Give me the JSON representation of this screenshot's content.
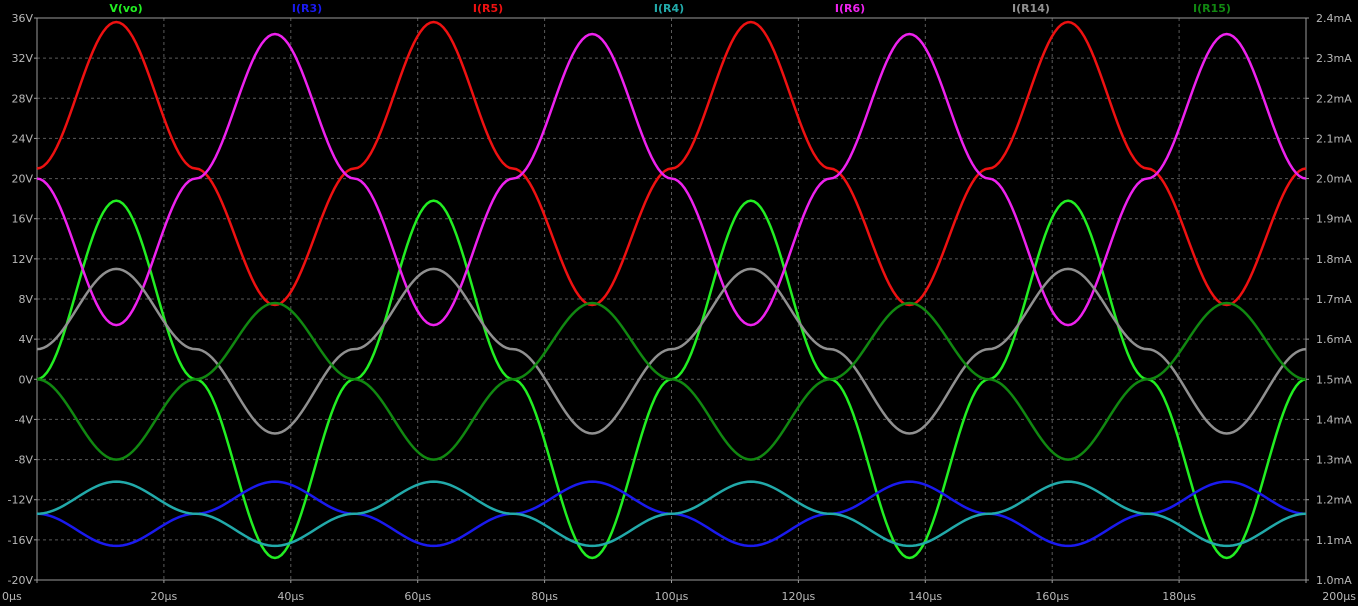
{
  "chart_data": {
    "type": "line",
    "x_unit": "µs",
    "xlim": [
      0,
      200
    ],
    "left_axis": {
      "unit": "V",
      "ylim": [
        -20,
        36
      ],
      "ticks": [
        -20,
        -16,
        -12,
        -8,
        -4,
        0,
        4,
        8,
        12,
        16,
        20,
        24,
        28,
        32,
        36
      ],
      "tick_labels": [
        "-20V",
        "-16V",
        "-12V",
        "-8V",
        "-4V",
        "0V",
        "4V",
        "8V",
        "12V",
        "16V",
        "20V",
        "24V",
        "28V",
        "32V",
        "36V"
      ]
    },
    "right_axis": {
      "unit": "mA",
      "ylim": [
        1.0,
        2.4
      ],
      "ticks": [
        1.0,
        1.1,
        1.2,
        1.3,
        1.4,
        1.5,
        1.6,
        1.7,
        1.8,
        1.9,
        2.0,
        2.1,
        2.2,
        2.3,
        2.4
      ],
      "tick_labels": [
        "1.0mA",
        "1.1mA",
        "1.2mA",
        "1.3mA",
        "1.4mA",
        "1.5mA",
        "1.6mA",
        "1.7mA",
        "1.8mA",
        "1.9mA",
        "2.0mA",
        "2.1mA",
        "2.2mA",
        "2.3mA",
        "2.4mA"
      ]
    },
    "x_ticks": [
      0,
      20,
      40,
      60,
      80,
      100,
      120,
      140,
      160,
      180,
      200
    ],
    "x_tick_labels": [
      "0µs",
      "20µs",
      "40µs",
      "60µs",
      "80µs",
      "100µs",
      "120µs",
      "140µs",
      "160µs",
      "180µs",
      "200µs"
    ],
    "grid": true,
    "legend_position": "top",
    "series": [
      {
        "name": "V(vo)",
        "axis": "left",
        "color": "#22ee22",
        "x": [
          0,
          12.5,
          25,
          37.5,
          50,
          62.5,
          75,
          87.5,
          100,
          112.5,
          125,
          137.5,
          150,
          162.5,
          175,
          187.5,
          200
        ],
        "y": [
          0,
          17.8,
          0,
          -17.8,
          0,
          17.8,
          0,
          -17.8,
          0,
          17.8,
          0,
          -17.8,
          0,
          17.8,
          0,
          -17.8,
          0
        ]
      },
      {
        "name": "I(R3)",
        "axis": "right",
        "color": "#1a1aee",
        "x": [
          0,
          12.5,
          25,
          37.5,
          50,
          62.5,
          75,
          87.5,
          100,
          112.5,
          125,
          137.5,
          150,
          162.5,
          175,
          187.5,
          200
        ],
        "y": [
          1.165,
          1.085,
          1.165,
          1.245,
          1.165,
          1.085,
          1.165,
          1.245,
          1.165,
          1.085,
          1.165,
          1.245,
          1.165,
          1.085,
          1.165,
          1.245,
          1.165
        ]
      },
      {
        "name": "I(R5)",
        "axis": "right",
        "color": "#ee1111",
        "x": [
          0,
          12.5,
          25,
          37.5,
          50,
          62.5,
          75,
          87.5,
          100,
          112.5,
          125,
          137.5,
          150,
          162.5,
          175,
          187.5,
          200
        ],
        "y": [
          2.025,
          2.39,
          2.025,
          1.685,
          2.025,
          2.39,
          2.025,
          1.685,
          2.025,
          2.39,
          2.025,
          1.685,
          2.025,
          2.39,
          2.025,
          1.685,
          2.025
        ]
      },
      {
        "name": "I(R4)",
        "axis": "right",
        "color": "#22aaaa",
        "x": [
          0,
          12.5,
          25,
          37.5,
          50,
          62.5,
          75,
          87.5,
          100,
          112.5,
          125,
          137.5,
          150,
          162.5,
          175,
          187.5,
          200
        ],
        "y": [
          1.165,
          1.245,
          1.165,
          1.085,
          1.165,
          1.245,
          1.165,
          1.085,
          1.165,
          1.245,
          1.165,
          1.085,
          1.165,
          1.245,
          1.165,
          1.085,
          1.165
        ]
      },
      {
        "name": "I(R6)",
        "axis": "right",
        "color": "#ee22ee",
        "x": [
          0,
          12.5,
          25,
          37.5,
          50,
          62.5,
          75,
          87.5,
          100,
          112.5,
          125,
          137.5,
          150,
          162.5,
          175,
          187.5,
          200
        ],
        "y": [
          2.0,
          1.635,
          2.0,
          2.36,
          2.0,
          1.635,
          2.0,
          2.36,
          2.0,
          1.635,
          2.0,
          2.36,
          2.0,
          1.635,
          2.0,
          2.36,
          2.0
        ]
      },
      {
        "name": "I(R14)",
        "axis": "right",
        "color": "#909090",
        "x": [
          0,
          12.5,
          25,
          37.5,
          50,
          62.5,
          75,
          87.5,
          100,
          112.5,
          125,
          137.5,
          150,
          162.5,
          175,
          187.5,
          200
        ],
        "y": [
          1.575,
          1.775,
          1.575,
          1.365,
          1.575,
          1.775,
          1.575,
          1.365,
          1.575,
          1.775,
          1.575,
          1.365,
          1.575,
          1.775,
          1.575,
          1.365,
          1.575
        ]
      },
      {
        "name": "I(R15)",
        "axis": "right",
        "color": "#118811",
        "x": [
          0,
          12.5,
          25,
          37.5,
          50,
          62.5,
          75,
          87.5,
          100,
          112.5,
          125,
          137.5,
          150,
          162.5,
          175,
          187.5,
          200
        ],
        "y": [
          1.5,
          1.3,
          1.5,
          1.69,
          1.5,
          1.3,
          1.5,
          1.69,
          1.5,
          1.3,
          1.5,
          1.69,
          1.5,
          1.3,
          1.5,
          1.69,
          1.5
        ]
      }
    ]
  }
}
